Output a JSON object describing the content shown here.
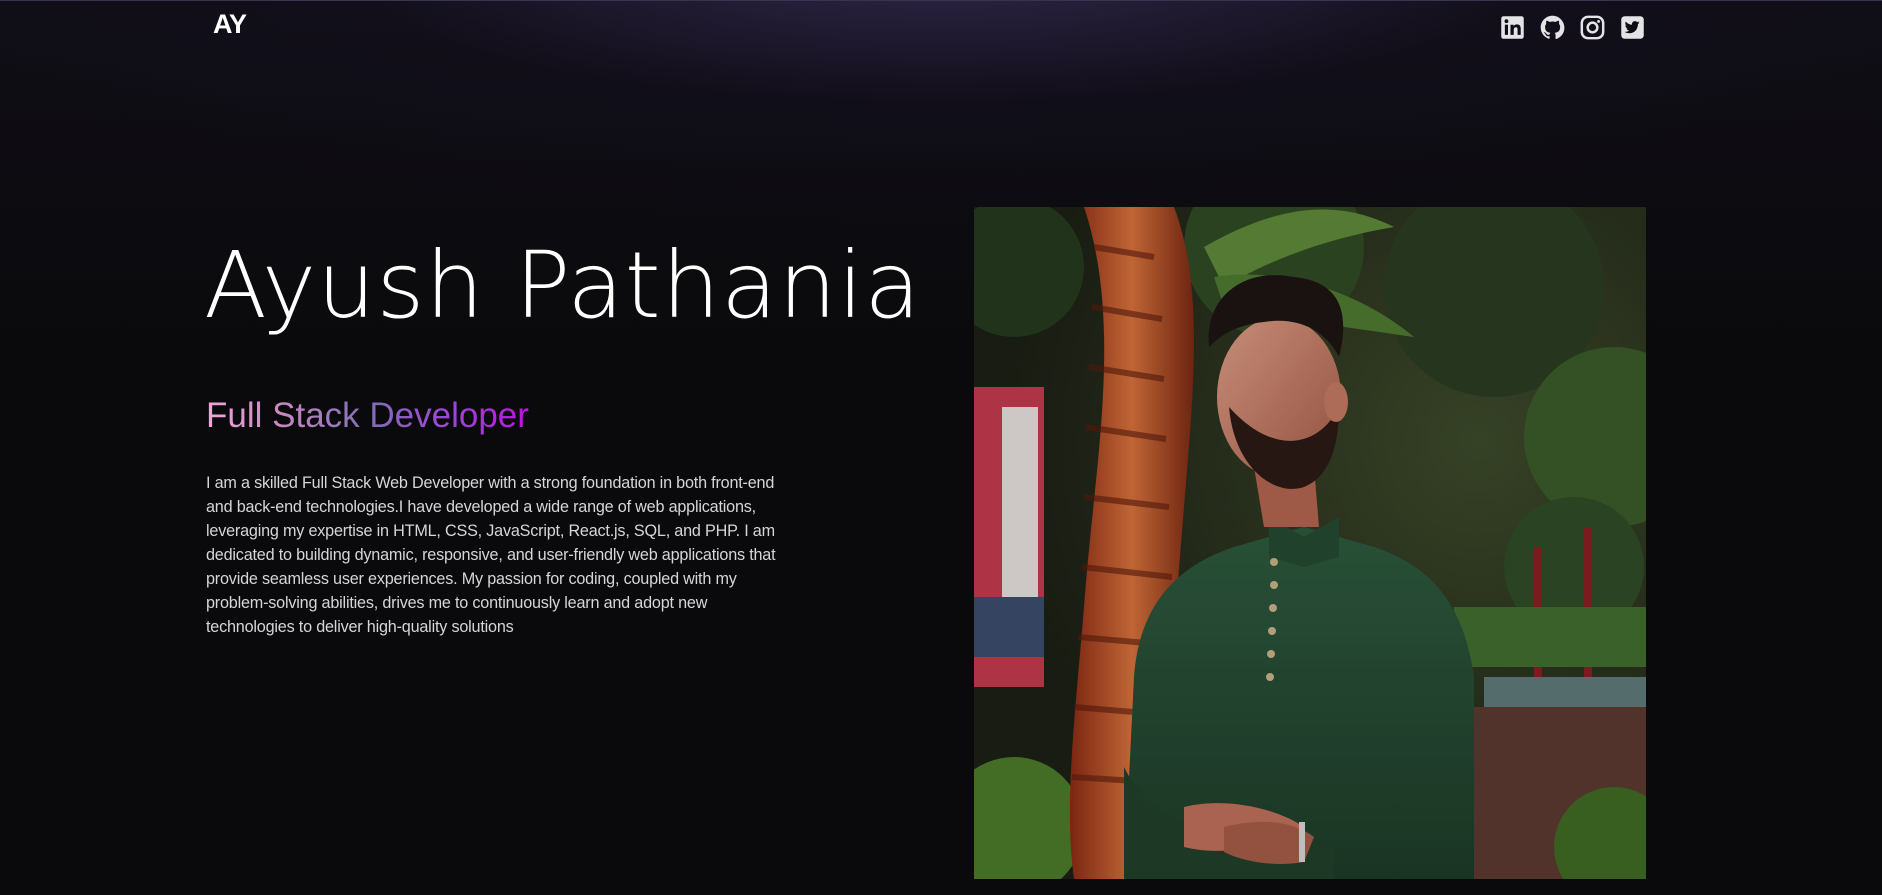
{
  "nav": {
    "logo": "AY",
    "socials": [
      {
        "name": "linkedin-icon",
        "label": "LinkedIn"
      },
      {
        "name": "github-icon",
        "label": "GitHub"
      },
      {
        "name": "instagram-icon",
        "label": "Instagram"
      },
      {
        "name": "twitter-icon",
        "label": "Twitter"
      }
    ]
  },
  "hero": {
    "name": "Ayush Pathania",
    "role": "Full Stack Developer",
    "bio": "I am a skilled Full Stack Web Developer with a strong foundation in both front-end and back-end technologies.I have developed a wide range of web applications, leveraging my expertise in HTML, CSS, JavaScript, React.js, SQL, and PHP. I am dedicated to building dynamic, responsive, and user-friendly web applications that provide seamless user experiences. My passion for coding, coupled with my problem-solving abilities, drives me to continuously learn and adopt new technologies to deliver high-quality solutions"
  },
  "colors": {
    "background": "#0a0a0c",
    "role_gradient_start": "#f6a3d8",
    "role_gradient_end": "#c012e4"
  }
}
